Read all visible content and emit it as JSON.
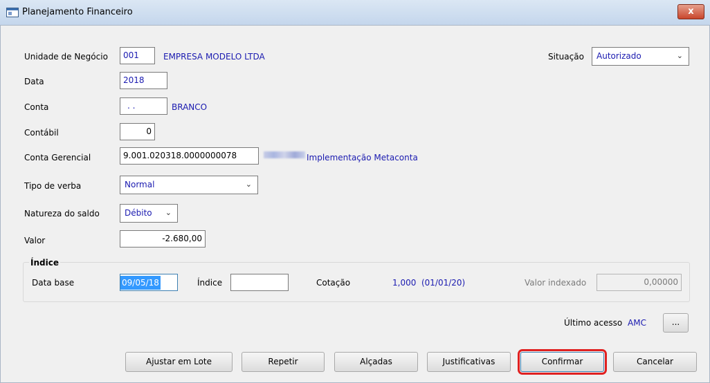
{
  "window": {
    "title": "Planejamento Financeiro",
    "close_label": "x"
  },
  "form": {
    "unidade_label": "Unidade de Negócio",
    "unidade_code": "001",
    "unidade_name": "EMPRESA MODELO LTDA",
    "situacao_label": "Situação",
    "situacao_value": "Autorizado",
    "data_label": "Data",
    "data_value": "2018",
    "conta_label": "Conta",
    "conta_value": ". .",
    "conta_name": "BRANCO",
    "contabil_label": "Contábil",
    "contabil_value": "0",
    "conta_gerencial_label": "Conta Gerencial",
    "conta_gerencial_value": "9.001.020318.0000000078",
    "conta_gerencial_name": "Implementação Metaconta",
    "tipo_verba_label": "Tipo de verba",
    "tipo_verba_value": "Normal",
    "natureza_label": "Natureza do saldo",
    "natureza_value": "Débito",
    "valor_label": "Valor",
    "valor_value": "-2.680,00"
  },
  "indice": {
    "group_title": "Índice",
    "data_base_label": "Data base",
    "data_base_value": "09/05/18",
    "indice_label": "Índice",
    "indice_value": "",
    "cotacao_label": "Cotação",
    "cotacao_value": "1,000  (01/01/20)",
    "valor_indexado_label": "Valor indexado",
    "valor_indexado_value": "0,00000"
  },
  "footer": {
    "ultimo_acesso_label": "Último acesso",
    "ultimo_acesso_value": "AMC",
    "dots_label": "..."
  },
  "buttons": {
    "ajustar": "Ajustar em Lote",
    "repetir": "Repetir",
    "alcadas": "Alçadas",
    "justificativas": "Justificativas",
    "confirmar": "Confirmar",
    "cancelar": "Cancelar"
  },
  "icons": {
    "app": "window-icon",
    "chevron": "chevron-down-icon",
    "close": "close-icon"
  }
}
